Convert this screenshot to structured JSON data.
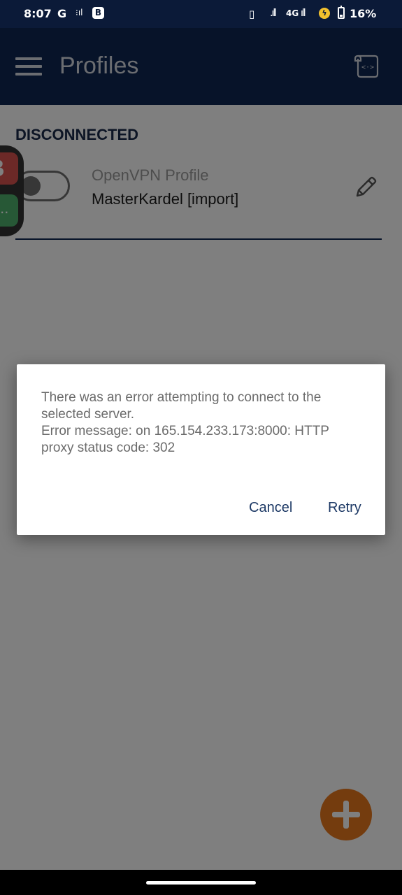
{
  "status_bar": {
    "time": "8:07",
    "google_letter": "G",
    "b_badge": "B",
    "network_type": "4G",
    "battery_percent": "16%"
  },
  "app_bar": {
    "title": "Profiles"
  },
  "profile_section": {
    "status": "DISCONNECTED",
    "profile_type": "OpenVPN Profile",
    "profile_name": "MasterKardel [import]"
  },
  "floating_bubble": {
    "top_letter": "B",
    "bottom_label": "..."
  },
  "dialog": {
    "message_line1": "There was an error attempting to connect to the selected server.",
    "message_line2": "Error message: on 165.154.233.173:8000: HTTP proxy status code: 302",
    "cancel_label": "Cancel",
    "retry_label": "Retry"
  },
  "colors": {
    "app_bar": "#0f2753",
    "status_bar": "#0b1a38",
    "fab": "#e8781d",
    "dialog_button_text": "#1e3a66"
  }
}
